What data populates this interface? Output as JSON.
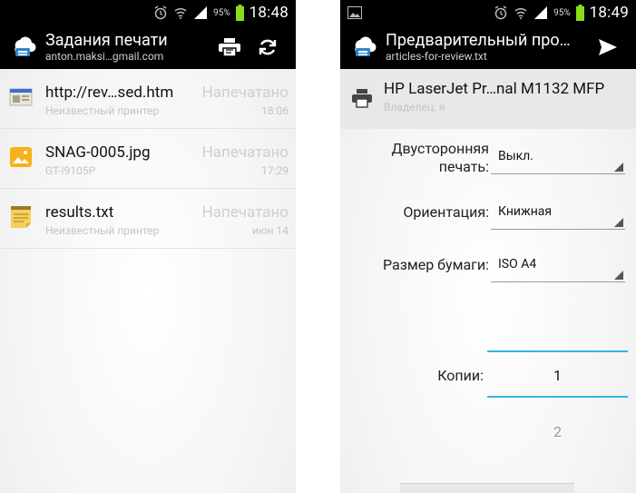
{
  "left": {
    "status": {
      "battery_pct": "95%",
      "time": "18:48"
    },
    "title": "Задания печати",
    "subtitle": "anton.maksi…gmail.com",
    "jobs": [
      {
        "name": "http://rev…sed.htm",
        "status": "Напечатано",
        "printer": "Неизвестный принтер",
        "time": "18:06",
        "icon": "webpage-icon"
      },
      {
        "name": "SNAG-0005.jpg",
        "status": "Напечатано",
        "printer": "GT-I9105P",
        "time": "17:29",
        "icon": "image-icon"
      },
      {
        "name": "results.txt",
        "status": "Напечатано",
        "printer": "Неизвестный принтер",
        "time": "июн 14",
        "icon": "note-icon"
      }
    ]
  },
  "right": {
    "status": {
      "battery_pct": "95%",
      "time": "18:49"
    },
    "title": "Предварительный про…",
    "subtitle": "articles-for-review.txt",
    "printer": {
      "name": "HP LaserJet Pr…nal M1132 MFP",
      "owner": "Владелец: я"
    },
    "options": {
      "duplex_label_1": "Двусторонняя",
      "duplex_label_2": "печать:",
      "duplex_value": "Выкл.",
      "orientation_label": "Ориентация:",
      "orientation_value": "Книжная",
      "paper_label": "Размер бумаги:",
      "paper_value": "ISO A4"
    },
    "copies": {
      "label": "Копии:",
      "value": "1",
      "next_value": "2"
    }
  },
  "colors": {
    "accent": "#33b5e5",
    "battery": "#8bdc1c",
    "bar": "#000000"
  }
}
